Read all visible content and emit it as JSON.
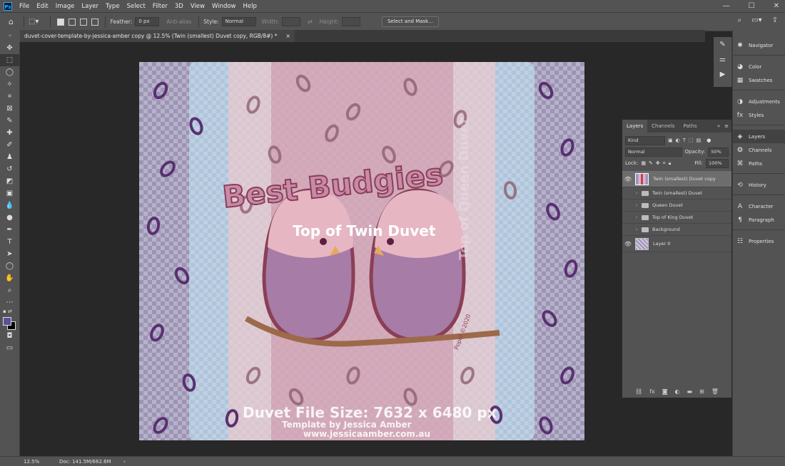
{
  "menubar": {
    "logo": "Ps",
    "items": [
      "File",
      "Edit",
      "Image",
      "Layer",
      "Type",
      "Select",
      "Filter",
      "3D",
      "View",
      "Window",
      "Help"
    ],
    "window_controls": {
      "minimize": "—",
      "maximize": "☐",
      "close": "✕"
    }
  },
  "options": {
    "feather_label": "Feather:",
    "feather_value": "0 px",
    "antialias_label": "Anti-alias",
    "style_label": "Style:",
    "style_value": "Normal",
    "width_label": "Width:",
    "height_label": "Height:",
    "select_mask_button": "Select and Mask..."
  },
  "document": {
    "tab_title": "duvet-cover-template-by-jessica-amber copy @ 12.5% (Twin (smallest) Duvet copy, RGB/8#) *",
    "close_glyph": "×"
  },
  "artwork": {
    "title": "Best Budgies",
    "label_center": "Top of Twin Duvet",
    "label_side": "Top of Queen Duvet",
    "file_size": "Duvet File Size: 7632 x 6480 px",
    "template_by": "Template by Jessica Amber",
    "website": "www.jessicaamber.com.au",
    "credit": "Popol ©2020"
  },
  "status": {
    "zoom": "12.5%",
    "doc": "Doc: 141.5M/662.6M",
    "arrow": "›"
  },
  "dock": {
    "items": [
      "Navigator",
      "Color",
      "Swatches",
      "Adjustments",
      "Styles",
      "Layers",
      "Channels",
      "Paths",
      "History",
      "Character",
      "Paragraph",
      "Properties"
    ]
  },
  "layers_panel": {
    "tabs": [
      "Layers",
      "Channels",
      "Paths"
    ],
    "filter_value": "Kind",
    "blend_mode": "Normal",
    "opacity_label": "Opacity:",
    "opacity_value": "50%",
    "lock_label": "Lock:",
    "fill_label": "Fill:",
    "fill_value": "100%",
    "layers": [
      {
        "name": "Twin (smallest) Duvet copy"
      },
      {
        "name": "Twin (smallest) Duvet"
      },
      {
        "name": "Queen Duvet"
      },
      {
        "name": "Top of King Duvet"
      },
      {
        "name": "Background"
      },
      {
        "name": "Layer 0"
      }
    ]
  },
  "colors": {
    "foreground": "#5b4f9a",
    "background": "#000000",
    "accent": "#31a8ff"
  }
}
